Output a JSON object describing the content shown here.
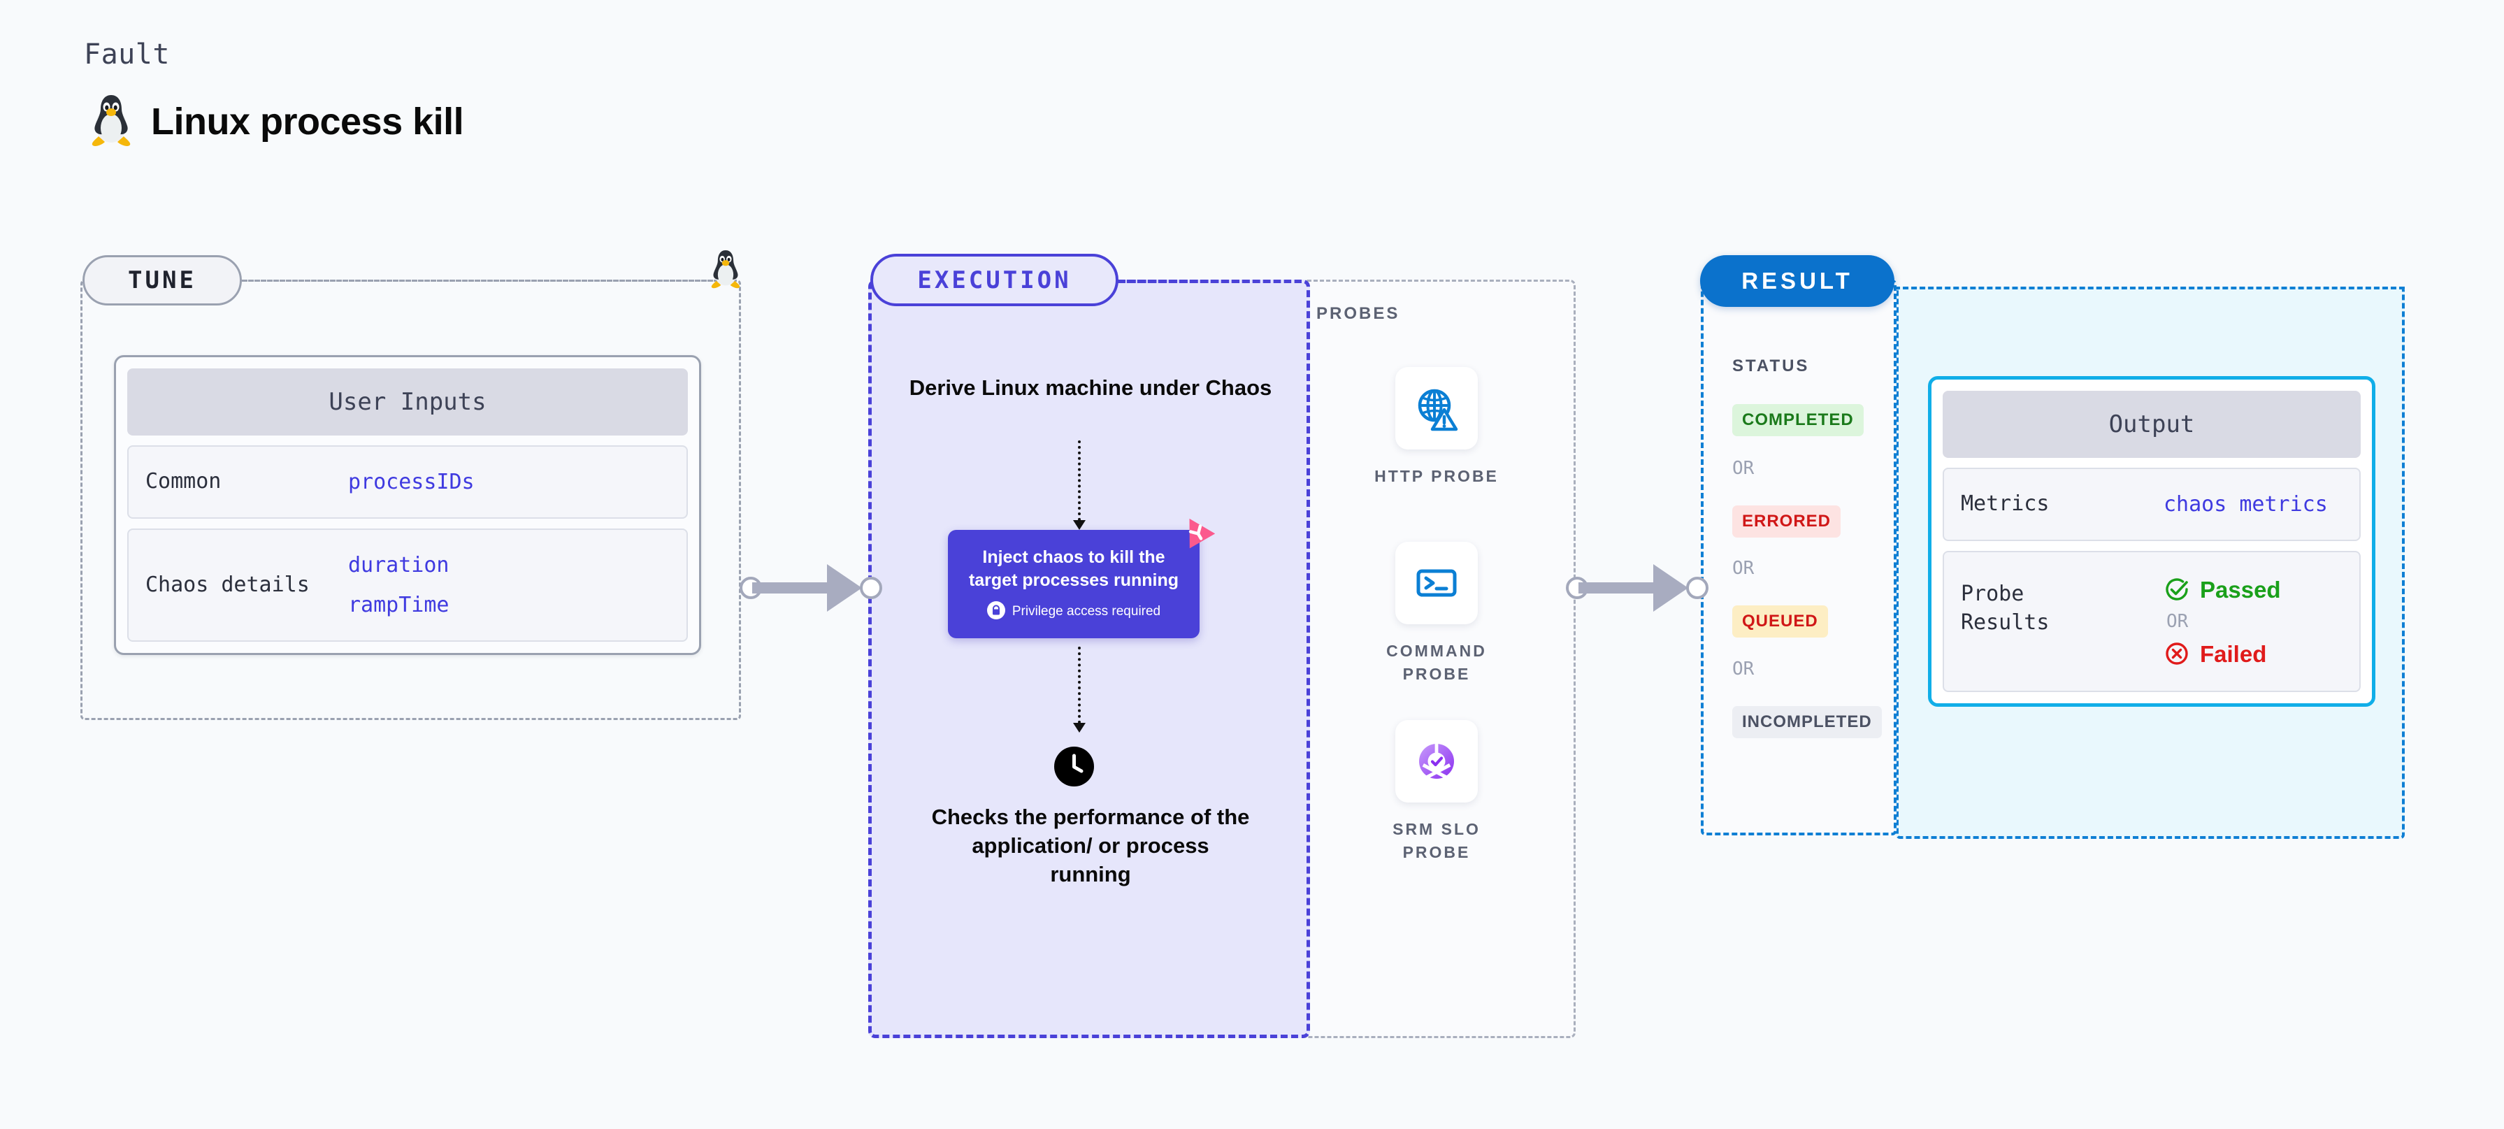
{
  "header": {
    "eyebrow": "Fault",
    "title": "Linux process kill",
    "icon": "linux-penguin-icon"
  },
  "tune": {
    "badge": "TUNE",
    "icon": "linux-penguin-icon",
    "card": {
      "title": "User Inputs",
      "rows": [
        {
          "label": "Common",
          "values": [
            "processIDs"
          ]
        },
        {
          "label": "Chaos details",
          "values": [
            "duration",
            "rampTime"
          ]
        }
      ]
    }
  },
  "execution": {
    "badge": "EXECUTION",
    "derive_text": "Derive Linux machine under Chaos",
    "chaos_box": {
      "text": "Inject chaos to kill the target processes running",
      "privilege_text": "Privilege access required",
      "lock_icon": "lock-icon",
      "corner_icon": "litmus-logo-icon",
      "bg_color": "#4a41d8"
    },
    "clock_icon": "clock-icon",
    "checks_text": "Checks the performance of the application/ or process running"
  },
  "probes": {
    "label": "PROBES",
    "items": [
      {
        "label": "HTTP PROBE",
        "icon": "globe-warning-icon",
        "color": "#0b7fd4"
      },
      {
        "label": "COMMAND PROBE",
        "icon": "terminal-icon",
        "color": "#0b7fd4"
      },
      {
        "label": "SRM SLO PROBE",
        "icon": "slo-donut-check-icon",
        "color": "#9b4df0"
      }
    ]
  },
  "result": {
    "badge": "RESULT",
    "status_label": "STATUS",
    "or_label": "OR",
    "statuses": [
      {
        "label": "COMPLETED",
        "bg": "#dcf5dc",
        "fg": "#1b7a1b"
      },
      {
        "label": "ERRORED",
        "bg": "#fde3e2",
        "fg": "#d01717"
      },
      {
        "label": "QUEUED",
        "bg": "#fdeec4",
        "fg": "#d01717"
      },
      {
        "label": "INCOMPLETED",
        "bg": "#eceef3",
        "fg": "#4b5163"
      }
    ],
    "output_card": {
      "title": "Output",
      "metrics_label": "Metrics",
      "metrics_value": "chaos metrics",
      "probe_results_label": "Probe Results",
      "passed_label": "Passed",
      "failed_label": "Failed",
      "or_label": "OR",
      "passed_icon": "check-circle-icon",
      "failed_icon": "x-circle-icon",
      "passed_color": "#1aa01a",
      "failed_color": "#e01b1b"
    }
  },
  "connectors": {
    "arrow_color": "#a8acc0"
  }
}
